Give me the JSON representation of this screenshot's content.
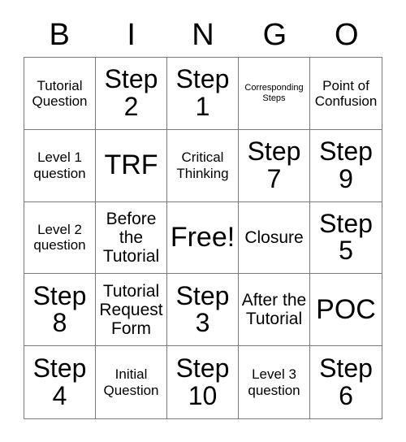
{
  "card": {
    "header_letters": [
      "B",
      "I",
      "N",
      "G",
      "O"
    ],
    "colors": {
      "background": "#ffffff",
      "text": "#000000",
      "border": "#7a7a7a"
    },
    "grid": {
      "rows": 5,
      "columns": 5,
      "free_space_label": "Free!",
      "cells": [
        {
          "text": "Tutorial Question",
          "size": "sm",
          "row": 1,
          "column": 1
        },
        {
          "text": "Step 2",
          "size": "lg",
          "row": 1,
          "column": 2
        },
        {
          "text": "Step 1",
          "size": "lg",
          "row": 1,
          "column": 3
        },
        {
          "text": "Corresponding Steps",
          "size": "xs",
          "row": 1,
          "column": 4
        },
        {
          "text": "Point of Confusion",
          "size": "sm",
          "row": 1,
          "column": 5
        },
        {
          "text": "Level 1 question",
          "size": "sm",
          "row": 2,
          "column": 1
        },
        {
          "text": "TRF",
          "size": "xl",
          "row": 2,
          "column": 2
        },
        {
          "text": "Critical Thinking",
          "size": "sm",
          "row": 2,
          "column": 3
        },
        {
          "text": "Step 7",
          "size": "lg",
          "row": 2,
          "column": 4
        },
        {
          "text": "Step 9",
          "size": "lg",
          "row": 2,
          "column": 5
        },
        {
          "text": "Level 2 question",
          "size": "sm",
          "row": 3,
          "column": 1
        },
        {
          "text": "Before the Tutorial",
          "size": "md",
          "row": 3,
          "column": 2
        },
        {
          "text": "Free!",
          "size": "xl",
          "row": 3,
          "column": 3
        },
        {
          "text": "Closure",
          "size": "md",
          "row": 3,
          "column": 4
        },
        {
          "text": "Step 5",
          "size": "lg",
          "row": 3,
          "column": 5
        },
        {
          "text": "Step 8",
          "size": "lg",
          "row": 4,
          "column": 1
        },
        {
          "text": "Tutorial Request Form",
          "size": "md",
          "row": 4,
          "column": 2
        },
        {
          "text": "Step 3",
          "size": "lg",
          "row": 4,
          "column": 3
        },
        {
          "text": "After the Tutorial",
          "size": "md",
          "row": 4,
          "column": 4
        },
        {
          "text": "POC",
          "size": "xl",
          "row": 4,
          "column": 5
        },
        {
          "text": "Step 4",
          "size": "lg",
          "row": 5,
          "column": 1
        },
        {
          "text": "Initial Question",
          "size": "sm",
          "row": 5,
          "column": 2
        },
        {
          "text": "Step 10",
          "size": "lg",
          "row": 5,
          "column": 3
        },
        {
          "text": "Level 3 question",
          "size": "sm",
          "row": 5,
          "column": 4
        },
        {
          "text": "Step 6",
          "size": "lg",
          "row": 5,
          "column": 5
        }
      ]
    }
  }
}
